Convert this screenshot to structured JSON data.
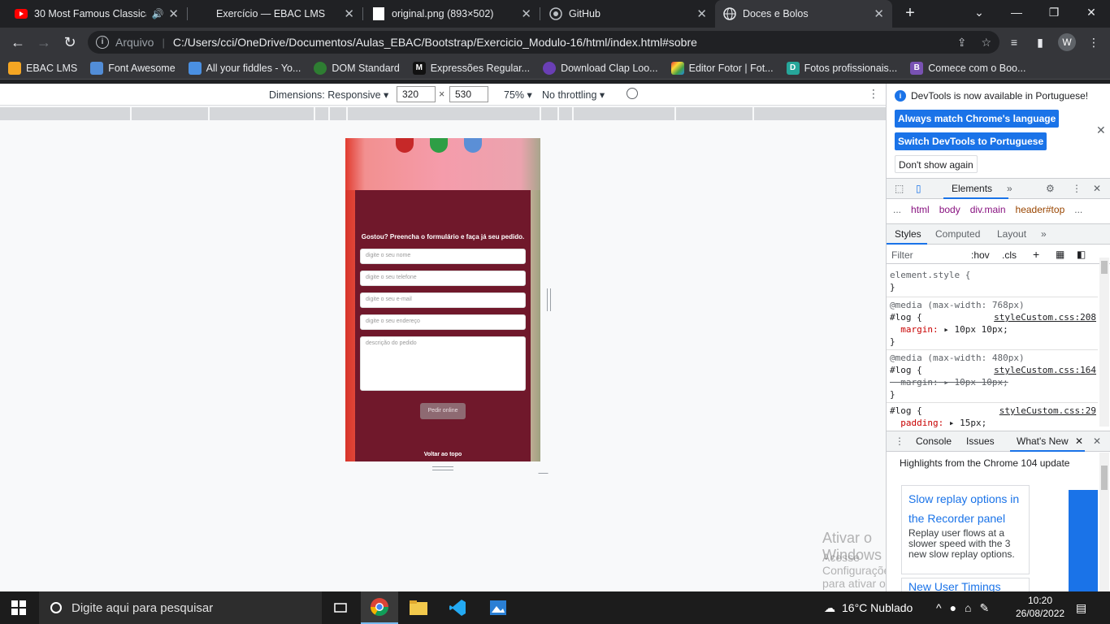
{
  "browser": {
    "tabs": [
      {
        "title": "30 Most Famous Classica",
        "icon": "youtube-icon"
      },
      {
        "title": "Exercício — EBAC LMS",
        "icon": "ebac-icon"
      },
      {
        "title": "original.png (893×502)",
        "icon": "image-icon"
      },
      {
        "title": "GitHub",
        "icon": "github-icon"
      },
      {
        "title": "Doces e Bolos",
        "icon": "globe-icon"
      }
    ],
    "omnibox": {
      "scheme": "Arquivo",
      "url": "C:/Users/cci/OneDrive/Documentos/Aulas_EBAC/Bootstrap/Exercicio_Modulo-16/html/index.html#sobre"
    },
    "profile_initial": "W"
  },
  "bookmarks": [
    {
      "label": "EBAC LMS",
      "color": "#f5a623"
    },
    {
      "label": "Font Awesome",
      "color": "#528dd7"
    },
    {
      "label": "All your fiddles - Yo...",
      "color": "#4a90e2"
    },
    {
      "label": "DOM Standard",
      "color": "#2e7d32"
    },
    {
      "label": "Expressões Regular...",
      "color": "#111111"
    },
    {
      "label": "Download Clap Loo...",
      "color": "#6a3fb5"
    },
    {
      "label": "Editor Fotor  |  Fot...",
      "color": "#e53935"
    },
    {
      "label": "Fotos profissionais...",
      "color": "#26a69a"
    },
    {
      "label": "Comece com o Boo...",
      "color": "#7952b3"
    }
  ],
  "device_toolbar": {
    "dimensions": "Dimensions: Responsive",
    "width": "320",
    "times": "×",
    "height": "530",
    "zoom": "75%",
    "throttling": "No throttling"
  },
  "page": {
    "form_title": "Gostou? Preencha o formulário e faça já seu pedido.",
    "fields": [
      "digite o seu nome",
      "digite o seu telefone",
      "digite o seu e-mail",
      "digite o seu endereço"
    ],
    "textarea": "descrição do pedido",
    "submit": "Pedir online",
    "back_to_top": "Voltar ao topo"
  },
  "watermark": {
    "line1": "Ativar o Windows",
    "line2": "Acesse Configurações para ativar o Windows."
  },
  "devtools": {
    "notice": "DevTools is now available in Portuguese!",
    "btn_match": "Always match Chrome's language",
    "btn_switch": "Switch DevTools to Portuguese",
    "btn_dont": "Don't show again",
    "main_tab": "Elements",
    "crumbs": [
      "...",
      "html",
      "body",
      "div.main",
      "header#top",
      "..."
    ],
    "subtabs": [
      "Styles",
      "Computed",
      "Layout"
    ],
    "filter": "Filter",
    "hov": ":hov",
    "cls": ".cls",
    "rules": [
      {
        "line1": "element.style {",
        "line2": "}"
      },
      {
        "media": "@media (max-width: 768px)",
        "selector": "#log {",
        "source": "styleCustom.css:208",
        "prop": "margin:",
        "value": "10px 10px;"
      },
      {
        "media": "@media (max-width: 480px)",
        "selector": "#log {",
        "source": "styleCustom.css:164",
        "prop": "margin:",
        "value": "10px−10px;"
      },
      {
        "selector": "#log {",
        "source": "styleCustom.css:29",
        "prop": "padding:",
        "value": "15px;"
      }
    ],
    "drawer_tabs": [
      "Console",
      "Issues",
      "What's New"
    ],
    "highlights": "Highlights from the Chrome 104 update",
    "card_title": "Slow replay options in the Recorder panel",
    "card_desc": "Replay user flows at a slower speed with the 3 new slow replay options.",
    "card2_title": "New User Timings"
  },
  "taskbar": {
    "search_placeholder": "Digite aqui para pesquisar",
    "weather": "16°C  Nublado",
    "time": "10:20",
    "date": "26/08/2022"
  }
}
